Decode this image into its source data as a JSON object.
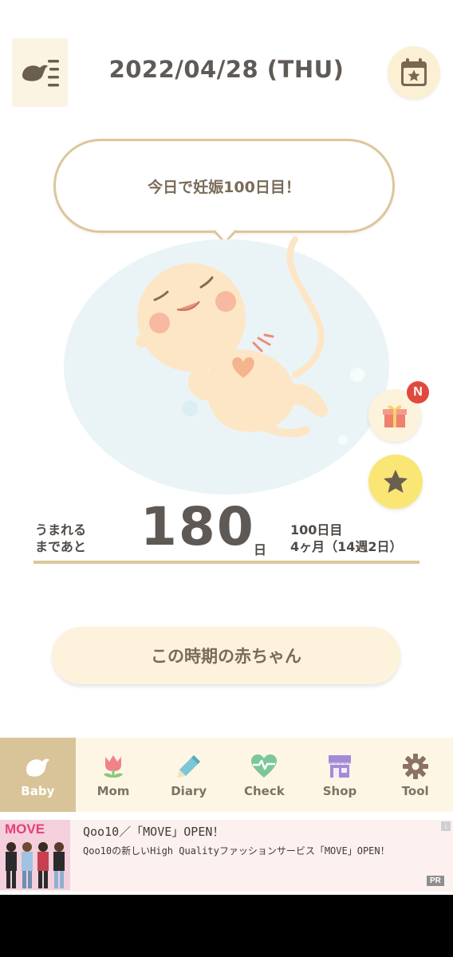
{
  "header": {
    "date": "2022/04/28 (THU)"
  },
  "bubble": {
    "message": "今日で妊娠100日目！"
  },
  "badges": {
    "new": "N"
  },
  "countdown": {
    "label_line1": "うまれる",
    "label_line2": "まであと",
    "days": "180",
    "unit": "日",
    "info_line1": "100日目",
    "info_line2": "4ヶ月（14週2日）"
  },
  "main_button": {
    "label": "この時期の赤ちゃん"
  },
  "tabs": [
    {
      "label": "Baby",
      "icon": "bird-icon",
      "active": true
    },
    {
      "label": "Mom",
      "icon": "tulip-icon",
      "active": false
    },
    {
      "label": "Diary",
      "icon": "pencil-icon",
      "active": false
    },
    {
      "label": "Check",
      "icon": "heart-pulse-icon",
      "active": false
    },
    {
      "label": "Shop",
      "icon": "store-icon",
      "active": false
    },
    {
      "label": "Tool",
      "icon": "gear-icon",
      "active": false
    }
  ],
  "ad": {
    "image_text": "MOVE",
    "title": "Qoo10／「MOVE」OPEN！",
    "description": "Qoo10の新しいHigh Qualityファッションサービス「MOVE」OPEN！",
    "info": "i",
    "pr": "PR"
  },
  "colors": {
    "accent": "#d9c49a",
    "bubble_border": "#dcc79a",
    "star": "#f9e674",
    "badge": "#e04a3d"
  }
}
